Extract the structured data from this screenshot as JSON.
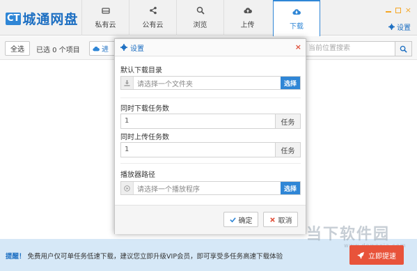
{
  "app": {
    "logo_badge": "CT",
    "logo_text": "城通网盘"
  },
  "nav": {
    "tabs": [
      {
        "label": "私有云",
        "icon": "hdd-icon"
      },
      {
        "label": "公有云",
        "icon": "share-icon"
      },
      {
        "label": "浏览",
        "icon": "search-icon"
      },
      {
        "label": "上传",
        "icon": "cloud-upload-icon"
      },
      {
        "label": "下载",
        "icon": "cloud-download-icon",
        "active": true
      }
    ]
  },
  "window_controls": {
    "close_glyph": "×"
  },
  "header": {
    "settings_label": "设置"
  },
  "toolbar": {
    "select_all": "全选",
    "selected_count": "已选 0 个项目",
    "progress_label": "进",
    "search_placeholder": "当前位置搜索"
  },
  "dialog": {
    "title": "设置",
    "close_glyph": "×",
    "download_dir_label": "默认下载目录",
    "download_dir_placeholder": "请选择一个文件夹",
    "choose_label": "选择",
    "concurrent_download_label": "同时下载任务数",
    "concurrent_download_value": "1",
    "concurrent_upload_label": "同时上传任务数",
    "concurrent_upload_value": "1",
    "task_unit": "任务",
    "player_path_label": "播放器路径",
    "player_path_placeholder": "请选择一个播放程序",
    "confirm_label": "确定",
    "cancel_label": "取消"
  },
  "notice": {
    "prefix": "提醒！",
    "text": "免费用户仅可单任务低速下载，建议您立即升级VIP会员，即可享受多任务高速下载体验",
    "upgrade_label": "立即提速"
  },
  "watermark": {
    "text": "当下软件园",
    "sub": "www.downxia.com"
  },
  "colors": {
    "accent": "#2f86d6",
    "brand": "#1d6fc2",
    "danger": "#e8533a",
    "notice_bg": "#d6e8f7"
  }
}
